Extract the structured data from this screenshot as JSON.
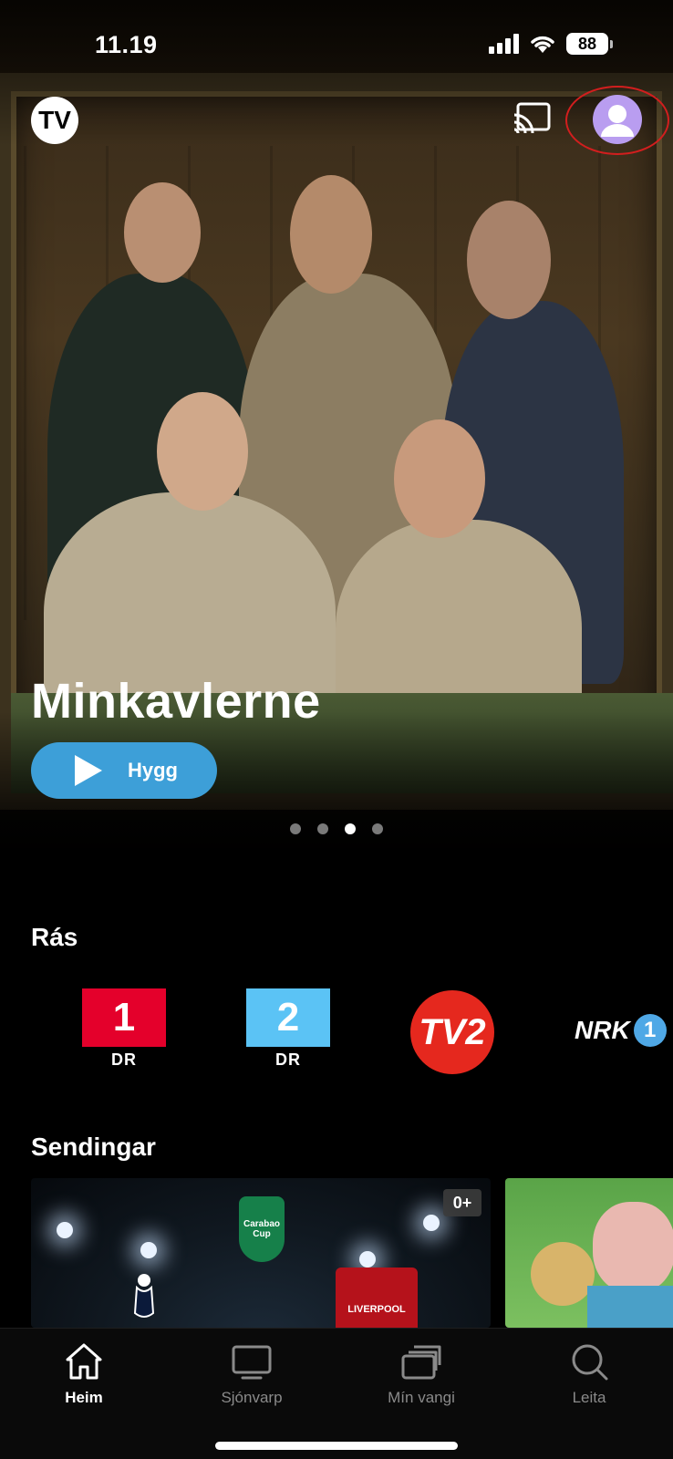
{
  "status": {
    "time": "11.19",
    "battery": "88"
  },
  "header": {
    "logo_text": "TV",
    "cast_icon": "cast-icon",
    "profile_icon": "avatar-icon"
  },
  "hero": {
    "title": "Minkavlerne",
    "play_label": "Hygg",
    "pagination": {
      "count": 4,
      "active_index": 2
    }
  },
  "channels_section": {
    "title": "Rás",
    "items": [
      {
        "name": "DR1",
        "number": "1",
        "label": "DR",
        "color": "#e4002b"
      },
      {
        "name": "DR2",
        "number": "2",
        "label": "DR",
        "color": "#5bc3f5"
      },
      {
        "name": "TV2",
        "label": "TV2",
        "color": "#e5281e"
      },
      {
        "name": "NRK1",
        "label": "NRK",
        "number": "1",
        "color": "#4fa8e6"
      }
    ]
  },
  "broadcasts_section": {
    "title": "Sendingar",
    "cards": [
      {
        "age_rating": "0+",
        "badge_text": "Carabao Cup",
        "team_text": "LIVERPOOL"
      },
      {}
    ]
  },
  "tab_bar": {
    "items": [
      {
        "label": "Heim",
        "icon": "home-icon",
        "active": true
      },
      {
        "label": "Sjónvarp",
        "icon": "tv-icon",
        "active": false
      },
      {
        "label": "Mín vangi",
        "icon": "stack-icon",
        "active": false
      },
      {
        "label": "Leita",
        "icon": "search-icon",
        "active": false
      }
    ]
  },
  "colors": {
    "accent": "#3d9fd8",
    "background": "#000000",
    "annotation": "#d21e1e"
  }
}
